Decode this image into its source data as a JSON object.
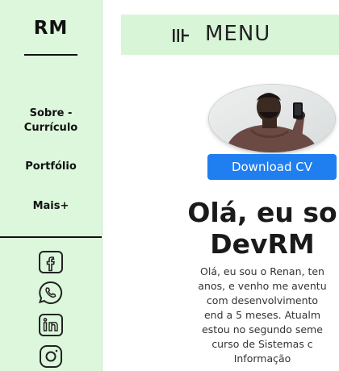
{
  "sidebar": {
    "brand": "RM",
    "items": [
      {
        "label": "Sobre -\nCurrículo"
      },
      {
        "label": "Portfólio"
      },
      {
        "label": "Mais+"
      }
    ],
    "socials": [
      "facebook-icon",
      "whatsapp-icon",
      "linkedin-icon",
      "instagram-icon"
    ]
  },
  "header": {
    "menu_label": "MENU"
  },
  "hero": {
    "download_label": "Download CV",
    "title": "Olá, eu so\nDevRM",
    "bio_lines": [
      "Olá, eu sou o Renan, ten",
      "anos, e venho me aventu",
      "com desenvolvimento",
      "end a 5 meses. Atualm",
      "estou no segundo seme",
      "curso de Sistemas c",
      "Informação"
    ]
  },
  "colors": {
    "sidebar_bg": "#dcf7dc",
    "topbar_bg": "#d8f5d8",
    "button_bg": "#1f7ff0"
  }
}
